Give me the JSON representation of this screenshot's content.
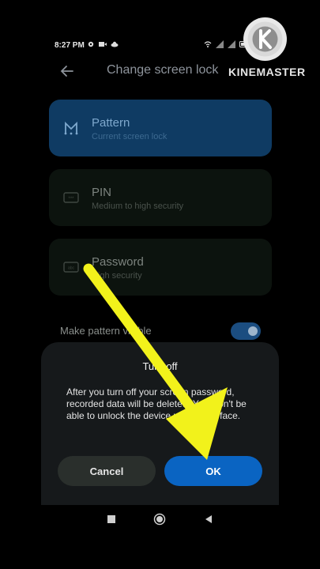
{
  "status_bar": {
    "time": "8:27 PM",
    "left_icons": [
      "gear-icon",
      "video-icon",
      "cloud-icon"
    ],
    "right_icons": [
      "wifi-icon",
      "signal-icon",
      "signal-icon",
      "battery-icon"
    ]
  },
  "watermark": {
    "text": "KINEMASTER",
    "logo_letter": "K"
  },
  "header": {
    "back_icon": "arrow-left-icon",
    "title": "Change screen lock"
  },
  "lock_options": [
    {
      "title": "Pattern",
      "subtitle": "Current screen lock",
      "icon": "pattern-icon",
      "selected": true
    },
    {
      "title": "PIN",
      "subtitle": "Medium to high security",
      "icon": "pin-icon",
      "selected": false
    },
    {
      "title": "Password",
      "subtitle": "High security",
      "icon": "password-icon",
      "selected": false
    }
  ],
  "toggle": {
    "label": "Make pattern visible",
    "on": true
  },
  "dialog": {
    "title": "Turn off",
    "message": "After you turn off your screen password, recorded data will be deleted. You won't be able to unlock the device using your face.",
    "cancel_label": "Cancel",
    "ok_label": "OK"
  },
  "nav_bar": {
    "buttons": [
      "square-icon",
      "circle-icon",
      "triangle-back-icon"
    ]
  },
  "colors": {
    "accent": "#0a64c2",
    "selected_card": "#0f3b63",
    "annotation_arrow": "#f2f21b"
  }
}
